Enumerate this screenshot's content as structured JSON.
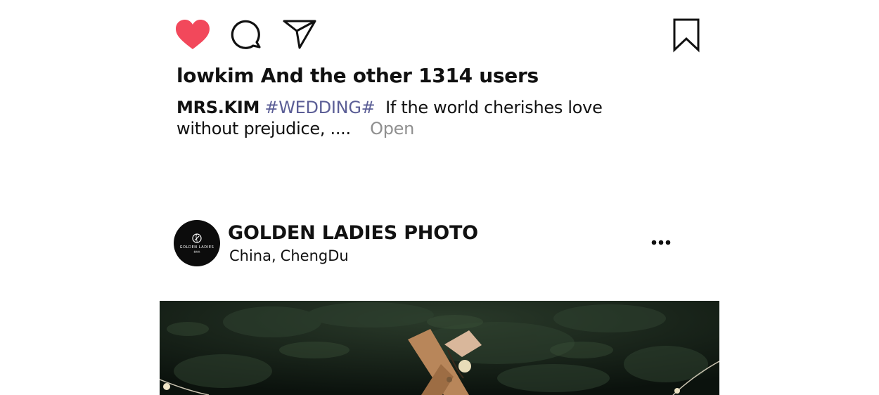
{
  "post_top": {
    "actions": {
      "like_icon": "heart-filled-icon",
      "like_color": "#f2485b",
      "comment_icon": "comment-bubble-icon",
      "share_icon": "paper-plane-icon",
      "save_icon": "bookmark-icon"
    },
    "likes_text": "lowkim And the other 1314 users",
    "caption": {
      "author": "MRS.KIM",
      "hashtag": "#WEDDING#",
      "text": "If the world cherishes love without prejudice, ....",
      "more_label": "Open"
    }
  },
  "post_next": {
    "avatar": {
      "logo_text": "GOLDEN LADIES",
      "logo_subtext": "金太太"
    },
    "account_name": "GOLDEN LADIES PHOTO",
    "location_country": "China,",
    "location_city": "ChengDu",
    "more_icon": "more-horizontal-icon"
  }
}
